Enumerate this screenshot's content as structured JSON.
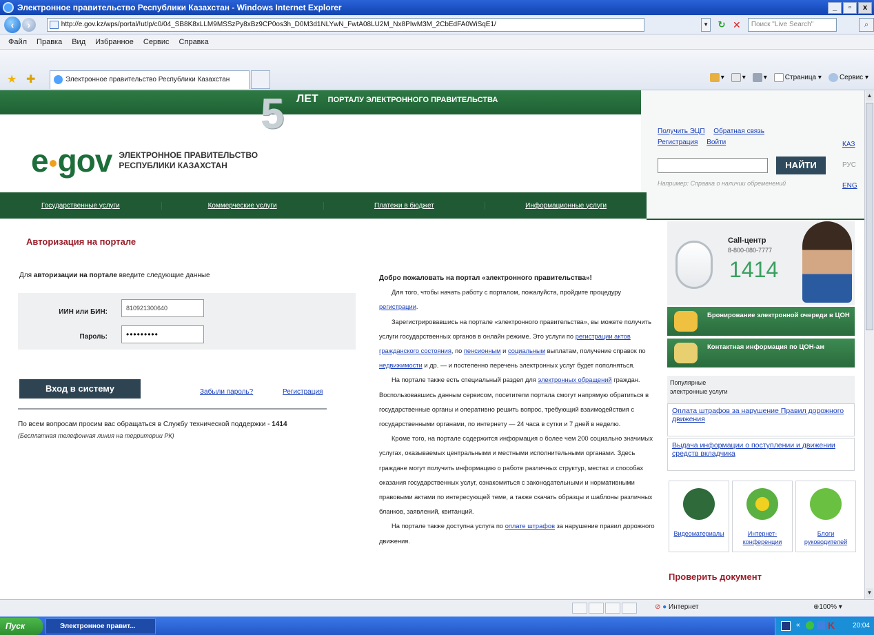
{
  "window": {
    "title": "Электронное правительство Республики Казахстан - Windows Internet Explorer",
    "minimize": "_",
    "maximize": "▫",
    "close": "x"
  },
  "address_bar": {
    "url": "http://e.gov.kz/wps/portal/!ut/p/c0/04_SB8K8xLLM9MSSzPy8xBz9CP0os3h_D0M3d1NLYwN_FwtA08LU2M_Nx8PIwM3M_2CbEdFA0WiSqE1/",
    "live_search_placeholder": "Поиск \"Live Search\""
  },
  "menu": [
    "Файл",
    "Правка",
    "Вид",
    "Избранное",
    "Сервис",
    "Справка"
  ],
  "tab": {
    "label": "Электронное правительство Республики Казахстан"
  },
  "command_bar": {
    "page": "Страница",
    "tools": "Сервис"
  },
  "banner": {
    "five": "5",
    "years": "ЛЕТ",
    "text": "ПОРТАЛУ ЭЛЕКТРОННОГО ПРАВИТЕЛЬСТВА"
  },
  "logo": {
    "mark_left": "e",
    "mark_right": "gov",
    "line1": "ЭЛЕКТРОННОЕ ПРАВИТЕЛЬСТВО",
    "line2": "РЕСПУБЛИКИ КАЗАХСТАН"
  },
  "header_links": {
    "get_eds": "Получить ЭЦП",
    "feedback": "Обратная связь",
    "register": "Регистрация",
    "login": "Войти"
  },
  "search": {
    "button": "НАЙТИ",
    "hint": "Например: Справка о наличии обременений"
  },
  "languages": [
    "КАЗ",
    "РУС",
    "ENG"
  ],
  "nav": [
    "Государственные услуги",
    "Коммерческие услуги",
    "Платежи в бюджет",
    "Информационные услуги"
  ],
  "auth": {
    "title": "Авторизация на портале",
    "intro_pre": "Для ",
    "intro_bold": "авторизации на портале",
    "intro_post": " введите следующие данные",
    "iin_label": "ИИН или БИН:",
    "iin_value": "810921300640",
    "password_label": "Пароль:",
    "password_value": "•••••••••",
    "login_button": "Вход в систему",
    "forgot": "Забыли пароль?",
    "register": "Регистрация",
    "support_pre": "По всем вопросам просим вас обращаться в Службу технической поддержки - ",
    "support_num": "1414",
    "support_note": "(Бесплатная телефонная линия на территории РК)"
  },
  "welcome": {
    "title": "Добро пожаловать на портал «электронного правительства»!",
    "p1_pre": "Для того, чтобы начать работу с порталом, пожалуйста, пройдите процедуру ",
    "p1_link": "регистрации",
    "p1_post": ".",
    "p2_a": "Зарегистрировавшись на портале «электронного правительства», вы можете получить услуги государственных органов в онлайн режиме. Это услуги по ",
    "p2_link1": "регистрации актов гражданского состояния",
    "p2_b": ", по ",
    "p2_link2": "пенсионным",
    "p2_c": " и ",
    "p2_link3": "социальным",
    "p2_d": " выплатам, получение справок по ",
    "p2_link4": "недвижимости",
    "p2_e": " и др. — и постепенно перечень электронных услуг будет пополняться.",
    "p3_a": "На портале также есть специальный раздел для ",
    "p3_link": "электронных обращений",
    "p3_b": " граждан. Воспользовавшись данным сервисом, посетители портала смогут напрямую обратиться в государственные органы и оперативно решить вопрос, требующий взаимодействия с государственными органами, по интернету — 24 часа в сутки и 7 дней в неделю.",
    "p4": "Кроме того, на портале содержится информация о более чем 200 социально значимых услугах, оказываемых центральными и местными исполнительными органами. Здесь граждане могут получить информацию о работе различных структур, местах и способах оказания государственных услуг, ознакомиться с законодательными и нормативными правовыми актами по интересующей теме, а также скачать образцы и шаблоны различных бланков, заявлений, квитанций.",
    "p5_a": "На портале также доступна услуга по ",
    "p5_link": "оплате штрафов",
    "p5_b": " за нарушение правил дорожного движения."
  },
  "callcenter": {
    "title": "Call-центр",
    "phone": "8-800-080-7777",
    "short": "1414"
  },
  "green_boxes": [
    "Бронирование электронной очереди в ЦОН",
    "Контактная информация по ЦОН-ам"
  ],
  "popular": {
    "head1": "Популярные",
    "head2": "электронные услуги",
    "items": [
      "Оплата штрафов за нарушение Правил дорожного движения",
      "Выдача информации о поступлении и движении средств вкладчика"
    ]
  },
  "media": [
    {
      "label": "Видеоматериалы"
    },
    {
      "label": "Интернет-конференции"
    },
    {
      "label": "Блоги руководителей"
    }
  ],
  "check_doc": "Проверить документ",
  "status": {
    "zone": "Интернет",
    "zoom": "100%"
  },
  "taskbar": {
    "start": "Пуск",
    "task": "Электронное правит...",
    "time": "20:04"
  },
  "colors": {
    "gov_green": "#1f5a34",
    "title_red": "#9a1f2a",
    "button_dark": "#2e4453",
    "link_blue": "#1a3fb8"
  }
}
